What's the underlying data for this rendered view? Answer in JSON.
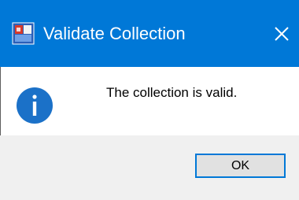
{
  "window": {
    "title": "Validate Collection",
    "app_icon": "collection-app-icon",
    "close_icon": "close-icon",
    "accent_color": "#0078d7"
  },
  "body": {
    "icon": "info-icon",
    "icon_color": "#1b71c8",
    "message": "The collection is valid."
  },
  "buttons": {
    "ok_label": "OK"
  }
}
